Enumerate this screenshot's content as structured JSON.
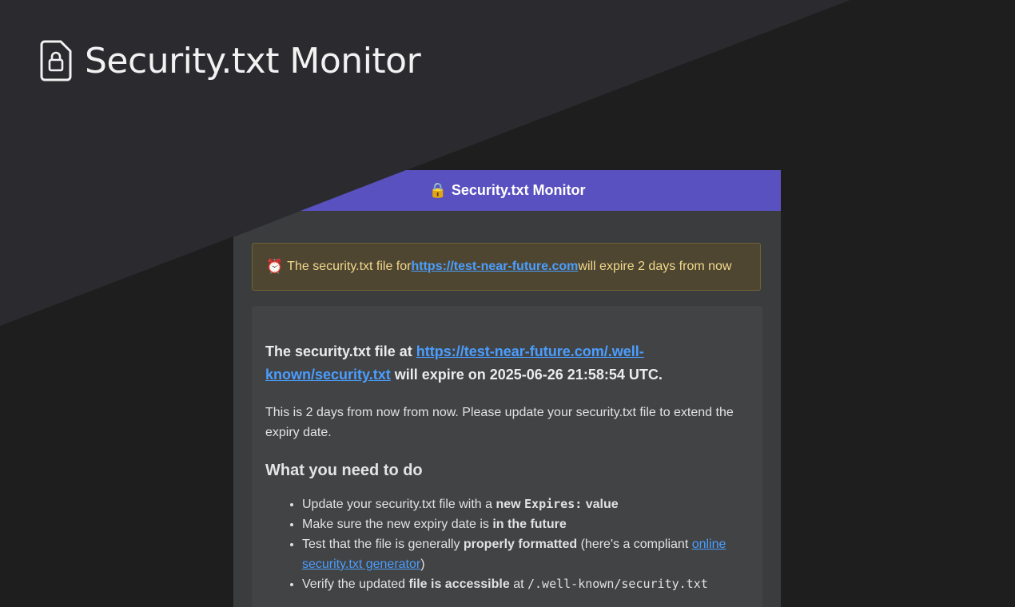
{
  "brand": {
    "title": "Security.txt Monitor",
    "icon": "file-lock-icon"
  },
  "email": {
    "header": {
      "icon": "🔒",
      "title": "Security.txt Monitor",
      "color": "#5a51c0"
    },
    "alert": {
      "icon": "⏰",
      "prefix": "The security.txt file for ",
      "link": "https://test-near-future.com",
      "suffix": " will expire 2 days from now"
    },
    "lead": {
      "prefix": "The security.txt file at ",
      "link": "https://test-near-future.com/.well-known/security.txt",
      "suffix": " will expire on 2025-06-26 21:58:54 UTC."
    },
    "paragraph": "This is 2 days from now from now. Please update your security.txt file to extend the expiry date.",
    "section_title": "What you need to do",
    "steps": [
      {
        "text": "Update your security.txt file with a ",
        "bold": "new ",
        "code": "Expires:",
        "bold2": " value"
      },
      {
        "text": "Make sure the new expiry date is ",
        "bold": "in the future"
      },
      {
        "text": "Test that the file is generally ",
        "bold": "properly formatted",
        "after": " (here's a compliant ",
        "link": "online security.txt generator",
        "end": ")"
      },
      {
        "text": "Verify the updated ",
        "bold": "file is accessible",
        "after": " at ",
        "code": "/.well-known/security.txt"
      }
    ]
  }
}
